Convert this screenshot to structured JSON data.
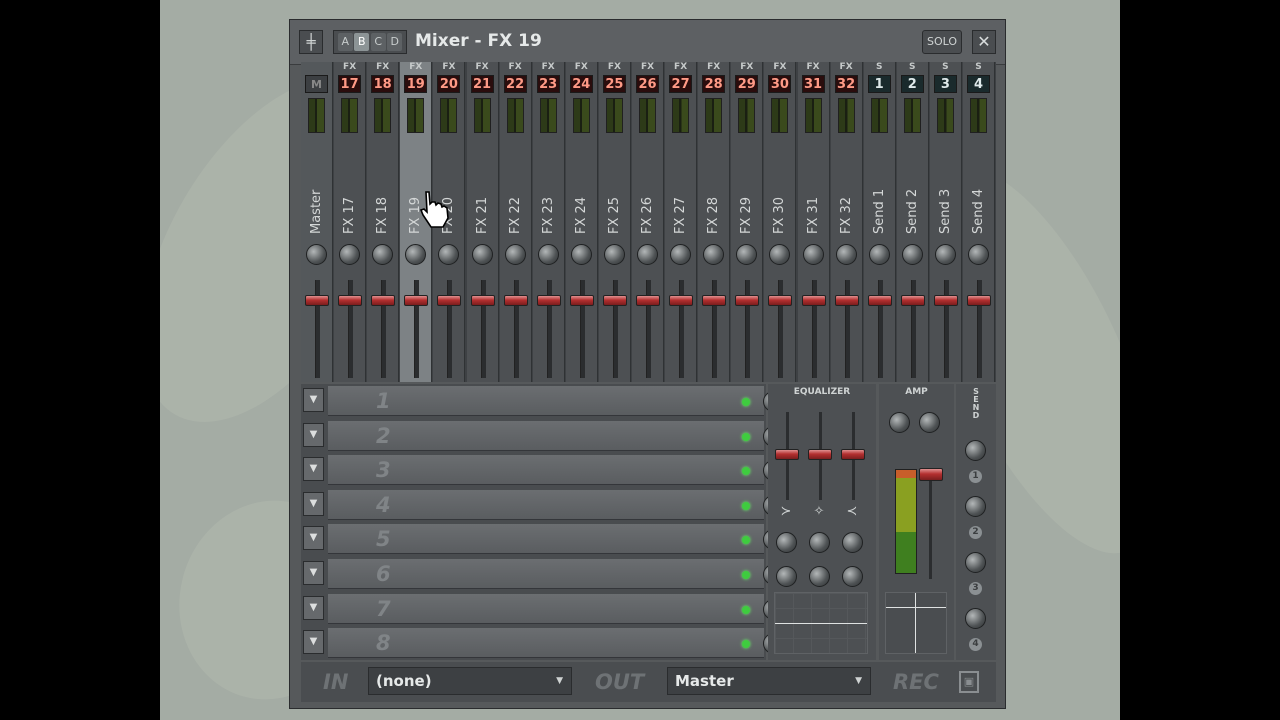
{
  "window": {
    "title": "Mixer - FX 19",
    "bank_buttons": [
      "A",
      "B",
      "C",
      "D"
    ],
    "active_bank": "B",
    "solo_label": "SOLO",
    "close_glyph": "✕",
    "system_glyph": "╪"
  },
  "strips": [
    {
      "tag": "",
      "num": "M",
      "name": "Master",
      "kind": "master"
    },
    {
      "tag": "FX",
      "num": "17",
      "name": "FX 17",
      "kind": "fx"
    },
    {
      "tag": "FX",
      "num": "18",
      "name": "FX 18",
      "kind": "fx"
    },
    {
      "tag": "FX",
      "num": "19",
      "name": "FX 19",
      "kind": "fx",
      "selected": true
    },
    {
      "tag": "FX",
      "num": "20",
      "name": "FX 20",
      "kind": "fx"
    },
    {
      "tag": "FX",
      "num": "21",
      "name": "FX 21",
      "kind": "fx"
    },
    {
      "tag": "FX",
      "num": "22",
      "name": "FX 22",
      "kind": "fx"
    },
    {
      "tag": "FX",
      "num": "23",
      "name": "FX 23",
      "kind": "fx"
    },
    {
      "tag": "FX",
      "num": "24",
      "name": "FX 24",
      "kind": "fx"
    },
    {
      "tag": "FX",
      "num": "25",
      "name": "FX 25",
      "kind": "fx"
    },
    {
      "tag": "FX",
      "num": "26",
      "name": "FX 26",
      "kind": "fx"
    },
    {
      "tag": "FX",
      "num": "27",
      "name": "FX 27",
      "kind": "fx"
    },
    {
      "tag": "FX",
      "num": "28",
      "name": "FX 28",
      "kind": "fx"
    },
    {
      "tag": "FX",
      "num": "29",
      "name": "FX 29",
      "kind": "fx"
    },
    {
      "tag": "FX",
      "num": "30",
      "name": "FX 30",
      "kind": "fx"
    },
    {
      "tag": "FX",
      "num": "31",
      "name": "FX 31",
      "kind": "fx"
    },
    {
      "tag": "FX",
      "num": "32",
      "name": "FX 32",
      "kind": "fx"
    },
    {
      "tag": "S",
      "num": "1",
      "name": "Send 1",
      "kind": "send"
    },
    {
      "tag": "S",
      "num": "2",
      "name": "Send 2",
      "kind": "send"
    },
    {
      "tag": "S",
      "num": "3",
      "name": "Send 3",
      "kind": "send"
    },
    {
      "tag": "S",
      "num": "4",
      "name": "Send 4",
      "kind": "send"
    }
  ],
  "effect_slots": [
    "1",
    "2",
    "3",
    "4",
    "5",
    "6",
    "7",
    "8"
  ],
  "equalizer": {
    "label": "EQUALIZER",
    "band_glyphs": [
      "≻",
      "✧",
      "≺"
    ]
  },
  "amp": {
    "label": "AMP"
  },
  "send": {
    "label": "SEND",
    "numbers": [
      "1",
      "2",
      "3",
      "4"
    ]
  },
  "bottom": {
    "in_label": "IN",
    "in_value": "(none)",
    "out_label": "OUT",
    "out_value": "Master",
    "rec_label": "REC"
  },
  "colors": {
    "selected_strip": "#7d8285",
    "fader_red": "#b43030",
    "led_green": "#3fcc3f"
  }
}
